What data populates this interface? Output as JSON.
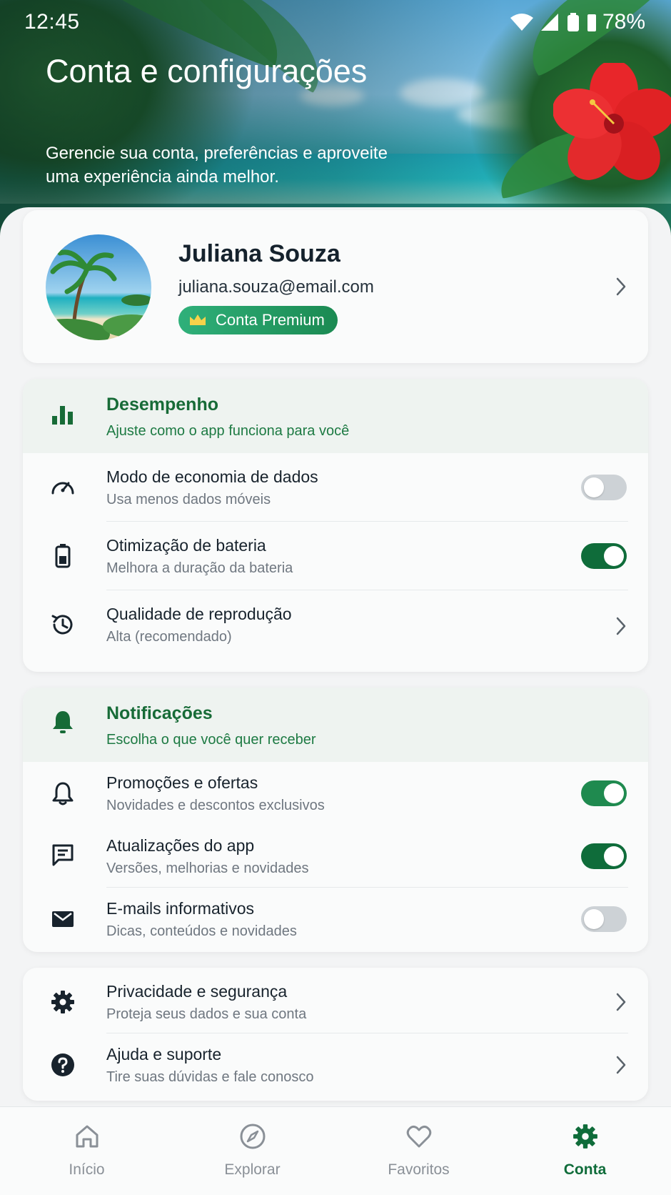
{
  "status_bar": {
    "time": "12:45",
    "battery": "78%"
  },
  "hero": {
    "title": "Conta e configurações",
    "subtitle": "Gerencie sua conta, preferências e aproveite uma experiência ainda melhor."
  },
  "profile": {
    "name": "Juliana Souza",
    "email": "juliana.souza@email.com",
    "badge": "Conta Premium"
  },
  "performance": {
    "title": "Desempenho",
    "subtitle": "Ajuste como o app funciona para você",
    "items": [
      {
        "title": "Modo de economia de dados",
        "subtitle": "Usa menos dados móveis",
        "icon": "speedometer-icon",
        "toggle": "off"
      },
      {
        "title": "Otimização de bateria",
        "subtitle": "Melhora a duração da bateria",
        "icon": "battery-icon",
        "toggle": "on"
      },
      {
        "title": "Qualidade de reprodução",
        "subtitle": "Alta (recomendado)",
        "icon": "history-icon",
        "toggle": null
      }
    ]
  },
  "notifications": {
    "title": "Notificações",
    "subtitle": "Escolha o que você quer receber",
    "items": [
      {
        "title": "Promoções e ofertas",
        "subtitle": "Novidades e descontos exclusivos",
        "icon": "bell-icon",
        "toggle": "on"
      },
      {
        "title": "Atualizações do app",
        "subtitle": "Versões, melhorias e novidades",
        "icon": "message-icon",
        "toggle": "on"
      },
      {
        "title": "E-mails informativos",
        "subtitle": "Dicas, conteúdos e novidades",
        "icon": "mail-icon",
        "toggle": "off"
      }
    ]
  },
  "more": {
    "items": [
      {
        "title": "Privacidade e segurança",
        "subtitle": "Proteja seus dados e sua conta",
        "icon": "gear-icon"
      },
      {
        "title": "Ajuda e suporte",
        "subtitle": "Tire suas dúvidas e fale conosco",
        "icon": "help-icon"
      }
    ]
  },
  "nav": {
    "items": [
      {
        "label": "Início",
        "icon": "home-icon"
      },
      {
        "label": "Explorar",
        "icon": "compass-icon"
      },
      {
        "label": "Favoritos",
        "icon": "heart-icon"
      },
      {
        "label": "Conta",
        "icon": "gear-icon"
      }
    ],
    "active": "Conta"
  },
  "colors": {
    "accent": "#0f6c3a",
    "accent_light": "#1f8a4f",
    "section_bg": "#eef3f0",
    "toggle_off": "#cdd2d6"
  }
}
